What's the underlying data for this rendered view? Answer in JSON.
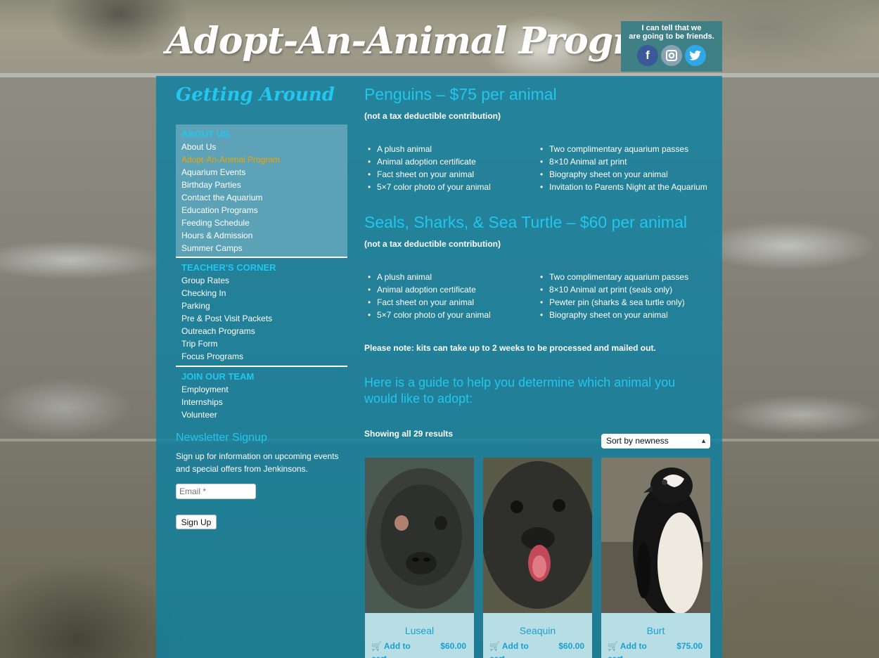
{
  "header": {
    "site_title": "Adopt-An-Animal Program",
    "social_text_line1": "I can tell that we",
    "social_text_line2": "are going to be friends.",
    "social_icons": [
      "facebook-icon",
      "instagram-icon",
      "twitter-icon"
    ]
  },
  "sidebar": {
    "title": "Getting Around",
    "about_head": "ABOUT US",
    "about_items": [
      "About Us",
      "Adopt-An-Animal Program",
      "Aquarium Events",
      "Birthday Parties",
      "Contact the Aquarium",
      "Education Programs",
      "Feeding Schedule",
      "Hours & Admission",
      "Summer Camps"
    ],
    "active_item": "Adopt-An-Animal Program",
    "teacher_head": "TEACHER'S CORNER",
    "teacher_items": [
      "Group Rates",
      "Checking In",
      "Parking",
      "Pre & Post Visit Packets",
      "Outreach Programs",
      "Trip Form",
      "Focus Programs"
    ],
    "team_head": "JOIN OUR TEAM",
    "team_items": [
      "Employment",
      "Internships",
      "Volunteer"
    ]
  },
  "newsletter": {
    "title": "Newsletter Signup",
    "text": "Sign up for information on upcoming events and special offers from Jenkinsons.",
    "email_placeholder": "Email *",
    "button": "Sign Up"
  },
  "content": {
    "penguins_title": "Penguins – $75 per animal",
    "penguins_note": "(not a tax deductible contribution)",
    "penguins_left": [
      "A plush animal",
      "Animal adoption certificate",
      "Fact sheet on your animal",
      "5×7 color photo of your animal"
    ],
    "penguins_right": [
      "Two complimentary aquarium passes",
      "8×10 Animal art print",
      "Biography sheet on your animal",
      "Invitation to Parents Night at the Aquarium"
    ],
    "seals_title": "Seals, Sharks, & Sea Turtle – $60 per animal",
    "seals_note": "(not a tax deductible contribution)",
    "seals_left": [
      "A plush animal",
      "Animal adoption certificate",
      "Fact sheet on your animal",
      "5×7 color photo of your animal"
    ],
    "seals_right": [
      "Two complimentary aquarium passes",
      "8×10 Animal art print (seals only)",
      "Pewter pin (sharks & sea turtle only)",
      "Biography sheet on your animal"
    ],
    "kits_note": "Please note: kits can take up to 2 weeks to be processed and mailed out.",
    "guide": "Here is a guide to help you determine which animal you would like to adopt:",
    "results": "Showing all 29 results",
    "sort_value": "Sort by newness"
  },
  "products": [
    {
      "name": "Luseal",
      "add": "Add to",
      "add2": "cart",
      "price": "$60.00"
    },
    {
      "name": "Seaquin",
      "add": "Add to",
      "add2": "cart",
      "price": "$60.00"
    },
    {
      "name": "Burt",
      "add": "Add to",
      "add2": "cart",
      "price": "$75.00"
    }
  ],
  "colors": {
    "accent": "#22c6ee",
    "active": "#f0a500",
    "panel": "#0e80a0",
    "card": "#b7dde5"
  }
}
